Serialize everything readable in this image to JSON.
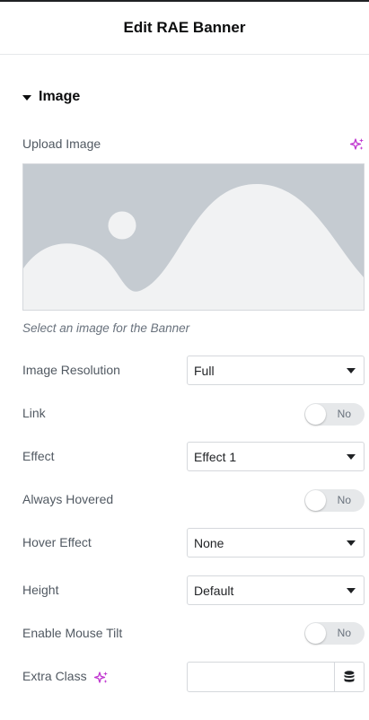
{
  "header": {
    "title": "Edit RAE Banner"
  },
  "section": {
    "title": "Image"
  },
  "image": {
    "label": "Upload Image",
    "description": "Select an image for the Banner"
  },
  "controls": {
    "resolution": {
      "label": "Image Resolution",
      "value": "Full"
    },
    "link": {
      "label": "Link",
      "toggle": "No"
    },
    "effect": {
      "label": "Effect",
      "value": "Effect 1"
    },
    "always_hovered": {
      "label": "Always Hovered",
      "toggle": "No"
    },
    "hover_effect": {
      "label": "Hover Effect",
      "value": "None"
    },
    "height": {
      "label": "Height",
      "value": "Default"
    },
    "mouse_tilt": {
      "label": "Enable Mouse Tilt",
      "toggle": "No"
    },
    "extra_class": {
      "label": "Extra Class",
      "value": ""
    }
  },
  "colors": {
    "ai_accent": "#c036d0",
    "placeholder_bg": "#c5cbd1",
    "placeholder_shape": "#f1f2f3"
  },
  "icons": {
    "caret": "caret-down-icon",
    "ai": "sparkle-icon",
    "dynamic": "database-icon"
  }
}
